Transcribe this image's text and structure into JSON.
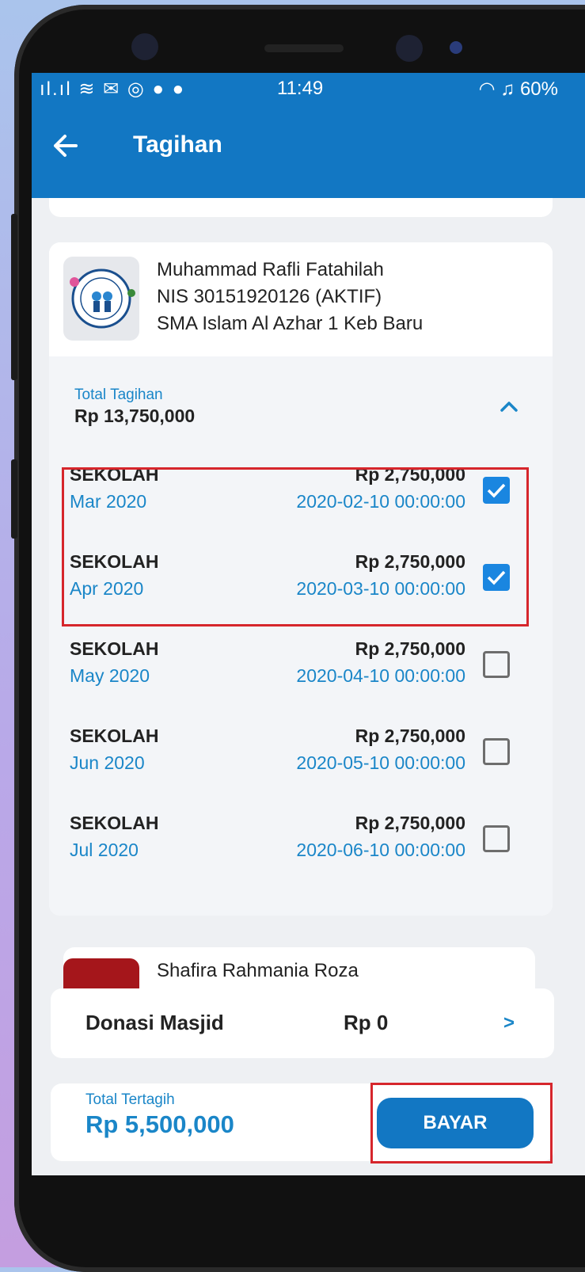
{
  "status_bar": {
    "time": "11:49",
    "battery": "60%"
  },
  "header": {
    "title": "Tagihan"
  },
  "student": {
    "name": "Muhammad Rafli Fatahilah",
    "nis": "NIS 30151920126 (AKTIF)",
    "school": "SMA Islam Al Azhar 1 Keb Baru"
  },
  "total_tagihan": {
    "label": "Total Tagihan",
    "value": "Rp 13,750,000"
  },
  "bills": [
    {
      "name": "SEKOLAH",
      "month": "Mar 2020",
      "amount": "Rp 2,750,000",
      "date": "2020-02-10 00:00:00",
      "checked": true
    },
    {
      "name": "SEKOLAH",
      "month": "Apr 2020",
      "amount": "Rp 2,750,000",
      "date": "2020-03-10 00:00:00",
      "checked": true
    },
    {
      "name": "SEKOLAH",
      "month": "May 2020",
      "amount": "Rp 2,750,000",
      "date": "2020-04-10 00:00:00",
      "checked": false
    },
    {
      "name": "SEKOLAH",
      "month": "Jun 2020",
      "amount": "Rp 2,750,000",
      "date": "2020-05-10 00:00:00",
      "checked": false
    },
    {
      "name": "SEKOLAH",
      "month": "Jul 2020",
      "amount": "Rp 2,750,000",
      "date": "2020-06-10 00:00:00",
      "checked": false
    }
  ],
  "next_student": {
    "name": "Shafira Rahmania Roza"
  },
  "donasi": {
    "label": "Donasi Masjid",
    "value": "Rp 0",
    "arrow": ">"
  },
  "footer": {
    "total_label": "Total Tertagih",
    "total_value": "Rp 5,500,000",
    "pay_button": "BAYAR"
  },
  "colors": {
    "primary": "#1277c3",
    "accent_text": "#1a86c8",
    "highlight": "#d6262c"
  }
}
